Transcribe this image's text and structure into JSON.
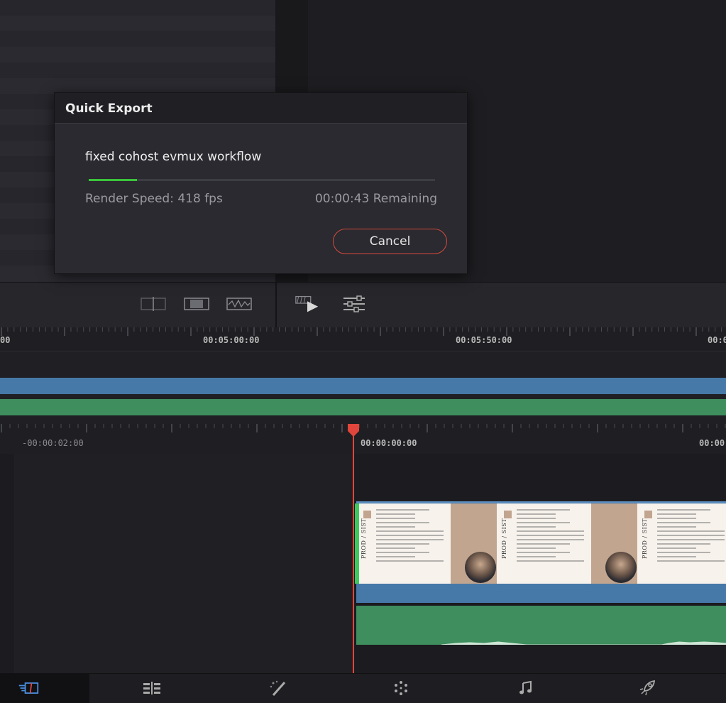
{
  "dialog": {
    "title": "Quick Export",
    "filename": "fixed cohost evmux workflow",
    "progress": 0.14,
    "render_speed": "Render Speed: 418 fps",
    "remaining": "00:00:43 Remaining",
    "cancel_label": "Cancel",
    "accent_color": "#d84a3b",
    "progress_color": "#39c43a"
  },
  "upper_ruler": {
    "labels": [
      "00",
      "00:05:00:00",
      "00:05:50:00",
      "00:0"
    ]
  },
  "lower_ruler": {
    "labels": [
      "-00:00:02:00",
      "00:00:00:00",
      "00:00"
    ]
  },
  "clip": {
    "thumb_text": "PROD / SIST",
    "video_color": "#4679a8",
    "audio_color": "#3e8e5e"
  },
  "toolbar_icons": [
    "inspector-layout-icon",
    "viewer-mode-icon",
    "audio-waveform-icon",
    "play-clip-icon",
    "render-settings-icon"
  ],
  "page_bar": {
    "pages": [
      "cut-page-icon",
      "edit-page-icon",
      "fusion-page-icon",
      "color-page-icon",
      "fairlight-page-icon",
      "deliver-page-icon"
    ],
    "active": "cut-page-icon"
  }
}
